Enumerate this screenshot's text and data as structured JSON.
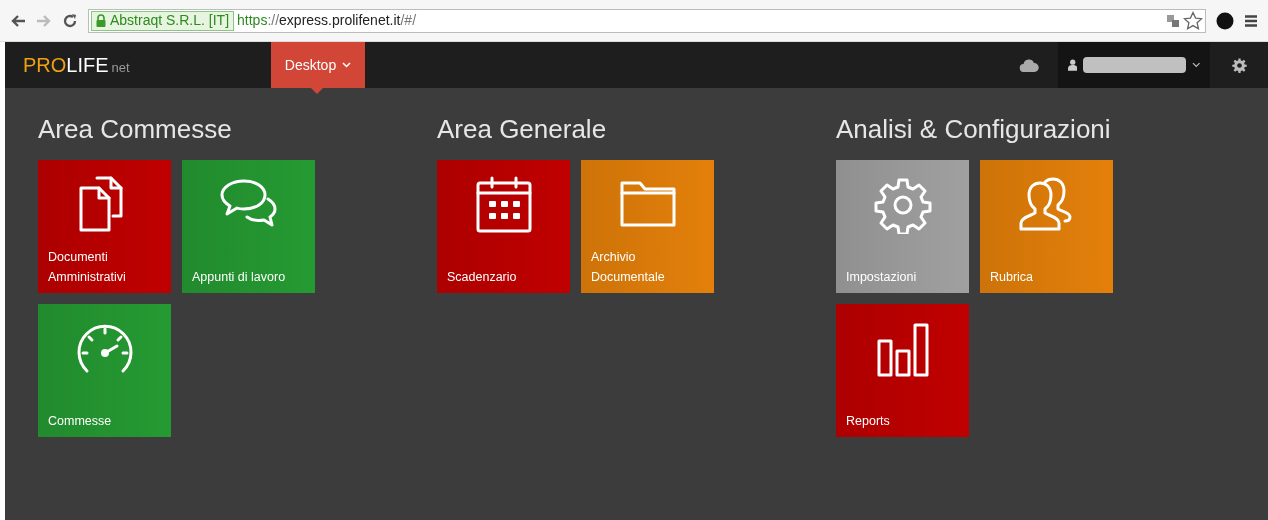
{
  "browser": {
    "identity": "Abstraqt S.R.L. [IT]",
    "url_scheme": "https",
    "url_separator": "://",
    "url_host": "express.prolifenet.it",
    "url_path": "/#/"
  },
  "header": {
    "logo": {
      "first": "PRO",
      "second": "LIFE",
      "suffix": "net"
    },
    "menu": [
      {
        "label": "Desktop",
        "selected": true
      }
    ]
  },
  "sections": [
    {
      "title": "Area Commesse",
      "tiles": [
        {
          "label": "Documenti Amministrativi",
          "color": "#c00000"
        },
        {
          "label": "Appunti di lavoro",
          "color": "#259a32"
        },
        {
          "label": "Commesse",
          "color": "#259a32"
        }
      ]
    },
    {
      "title": "Area Generale",
      "tiles": [
        {
          "label": "Scadenzario",
          "color": "#c00000"
        },
        {
          "label": "Archivio Documentale",
          "color": "#e4800a"
        }
      ]
    },
    {
      "title": "Analisi & Configurazioni",
      "tiles": [
        {
          "label": "Impostazioni",
          "color": "#a0a0a0"
        },
        {
          "label": "Rubrica",
          "color": "#e4800a"
        },
        {
          "label": "Reports",
          "color": "#c00000"
        }
      ]
    }
  ]
}
